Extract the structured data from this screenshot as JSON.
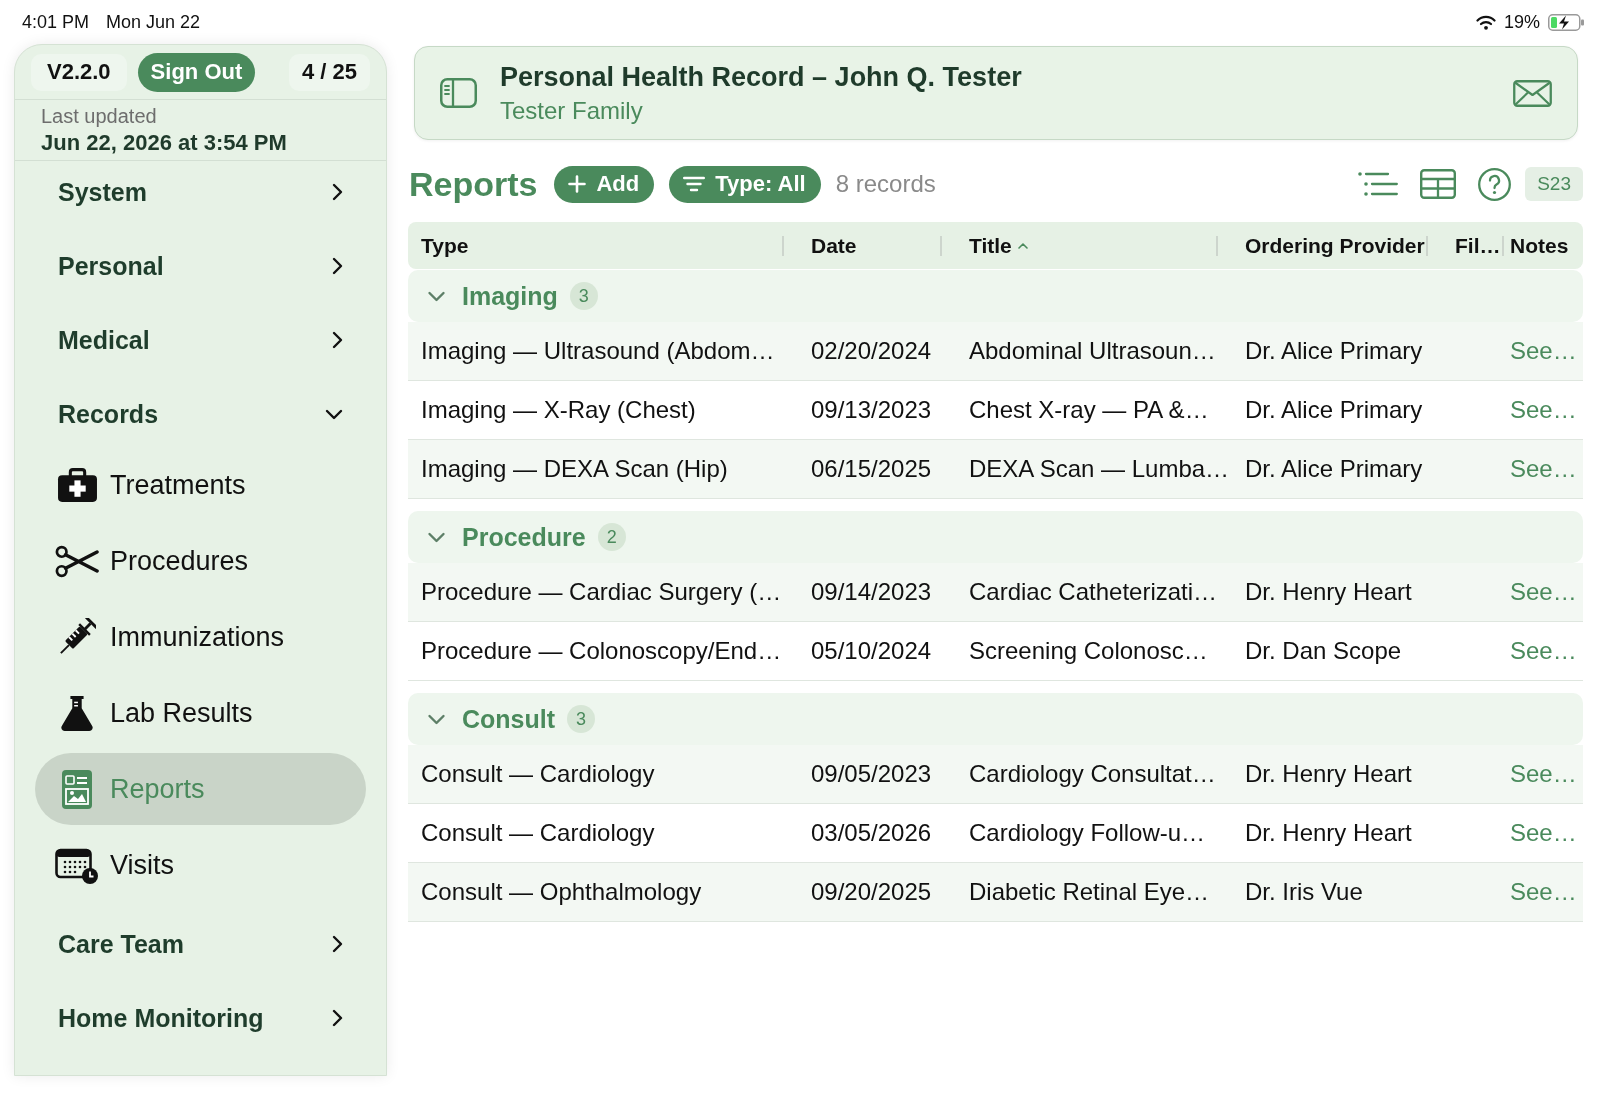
{
  "status_bar": {
    "time": "4:01 PM",
    "date": "Mon Jun 22",
    "battery": "19%"
  },
  "sidebar": {
    "version": "V2.2.0",
    "sign_out": "Sign Out",
    "counter": "4 / 25",
    "last_updated_label": "Last updated",
    "last_updated": "Jun 22, 2026 at 3:54 PM",
    "items": [
      {
        "label": "System",
        "expanded": false
      },
      {
        "label": "Personal",
        "expanded": false
      },
      {
        "label": "Medical",
        "expanded": false
      },
      {
        "label": "Records",
        "expanded": true,
        "children": [
          {
            "label": "Treatments",
            "selected": false
          },
          {
            "label": "Procedures",
            "selected": false
          },
          {
            "label": "Immunizations",
            "selected": false
          },
          {
            "label": "Lab Results",
            "selected": false
          },
          {
            "label": "Reports",
            "selected": true
          },
          {
            "label": "Visits",
            "selected": false
          }
        ]
      },
      {
        "label": "Care Team",
        "expanded": false
      },
      {
        "label": "Home Monitoring",
        "expanded": false
      }
    ]
  },
  "header": {
    "title": "Personal Health Record – John Q. Tester",
    "subtitle": "Tester Family"
  },
  "toolbar": {
    "title": "Reports",
    "add_button": "Add",
    "filter_button": "Type: All",
    "record_count": "8 records",
    "tag": "S23"
  },
  "table": {
    "columns": [
      {
        "label": "Type",
        "sorted": false
      },
      {
        "label": "Date",
        "sorted": false
      },
      {
        "label": "Title",
        "sorted": true
      },
      {
        "label": "Ordering Provider",
        "sorted": false
      },
      {
        "label": "Fil…",
        "sorted": false
      },
      {
        "label": "Notes",
        "sorted": false
      }
    ],
    "groups": [
      {
        "name": "Imaging",
        "count": "3",
        "expanded": true,
        "rows": [
          {
            "type": "Imaging — Ultrasound (Abdom…",
            "date": "02/20/2024",
            "title": "Abdominal Ultrasoun…",
            "ordering_provider": "Dr. Alice Primary",
            "notes": "See…"
          },
          {
            "type": "Imaging — X-Ray (Chest)",
            "date": "09/13/2023",
            "title": "Chest X-ray — PA &…",
            "ordering_provider": "Dr. Alice Primary",
            "notes": "See…"
          },
          {
            "type": "Imaging — DEXA Scan (Hip)",
            "date": "06/15/2025",
            "title": "DEXA Scan — Lumba…",
            "ordering_provider": "Dr. Alice Primary",
            "notes": "See…"
          }
        ]
      },
      {
        "name": "Procedure",
        "count": "2",
        "expanded": true,
        "rows": [
          {
            "type": "Procedure — Cardiac Surgery (…",
            "date": "09/14/2023",
            "title": "Cardiac Catheterizati…",
            "ordering_provider": "Dr. Henry Heart",
            "notes": "See…"
          },
          {
            "type": "Procedure — Colonoscopy/End…",
            "date": "05/10/2024",
            "title": "Screening Colonosc…",
            "ordering_provider": "Dr. Dan Scope",
            "notes": "See…"
          }
        ]
      },
      {
        "name": "Consult",
        "count": "3",
        "expanded": true,
        "rows": [
          {
            "type": "Consult — Cardiology",
            "date": "09/05/2023",
            "title": "Cardiology Consultat…",
            "ordering_provider": "Dr. Henry Heart",
            "notes": "See…"
          },
          {
            "type": "Consult — Cardiology",
            "date": "03/05/2026",
            "title": "Cardiology Follow-u…",
            "ordering_provider": "Dr. Henry Heart",
            "notes": "See…"
          },
          {
            "type": "Consult — Ophthalmology",
            "date": "09/20/2025",
            "title": "Diabetic Retinal Eye…",
            "ordering_provider": "Dr. Iris Vue",
            "notes": "See…"
          }
        ]
      }
    ]
  }
}
